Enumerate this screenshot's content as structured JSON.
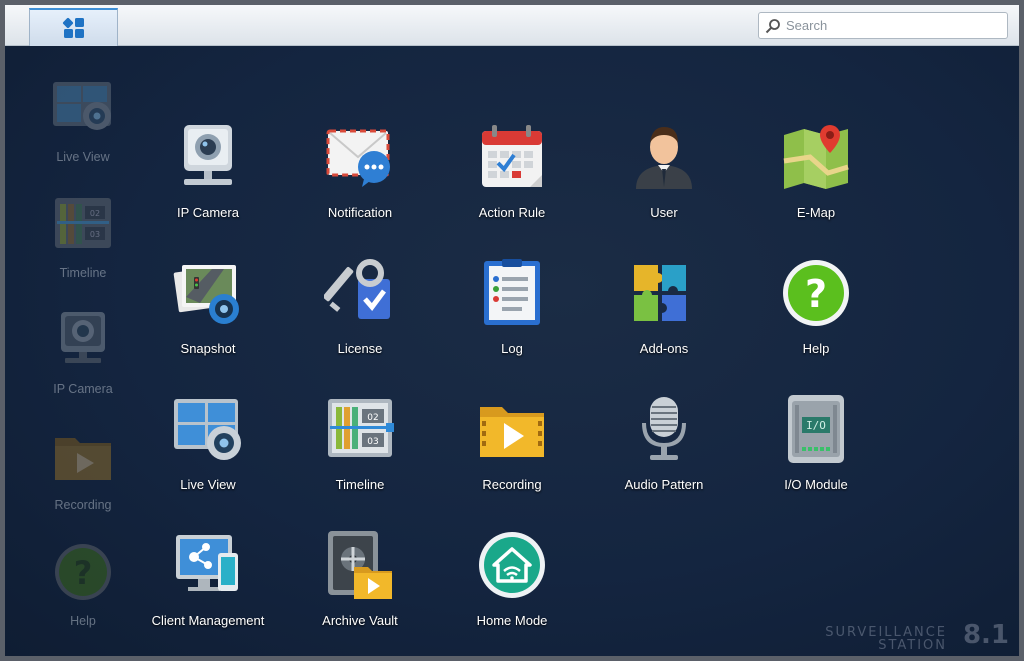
{
  "topbar": {
    "search": {
      "placeholder": "Search",
      "icon": "search-icon"
    },
    "main_menu_icon": "grid-icon"
  },
  "sidebar": {
    "items": [
      {
        "label": "Live View",
        "icon": "live-view-icon"
      },
      {
        "label": "Timeline",
        "icon": "timeline-icon"
      },
      {
        "label": "IP Camera",
        "icon": "ip-camera-icon"
      },
      {
        "label": "Recording",
        "icon": "recording-icon"
      },
      {
        "label": "Help",
        "icon": "help-icon"
      }
    ]
  },
  "apps": [
    {
      "label": "IP Camera",
      "icon": "ip-camera-icon"
    },
    {
      "label": "Notification",
      "icon": "notification-icon"
    },
    {
      "label": "Action Rule",
      "icon": "action-rule-icon"
    },
    {
      "label": "User",
      "icon": "user-icon"
    },
    {
      "label": "E-Map",
      "icon": "e-map-icon"
    },
    {
      "label": "Snapshot",
      "icon": "snapshot-icon"
    },
    {
      "label": "License",
      "icon": "license-icon"
    },
    {
      "label": "Log",
      "icon": "log-icon"
    },
    {
      "label": "Add-ons",
      "icon": "add-ons-icon"
    },
    {
      "label": "Help",
      "icon": "help-icon"
    },
    {
      "label": "Live View",
      "icon": "live-view-icon"
    },
    {
      "label": "Timeline",
      "icon": "timeline-icon"
    },
    {
      "label": "Recording",
      "icon": "recording-icon"
    },
    {
      "label": "Audio Pattern",
      "icon": "audio-pattern-icon"
    },
    {
      "label": "I/O Module",
      "icon": "io-module-icon"
    },
    {
      "label": "Client Management",
      "icon": "client-management-icon"
    },
    {
      "label": "Archive Vault",
      "icon": "archive-vault-icon"
    },
    {
      "label": "Home Mode",
      "icon": "home-mode-icon"
    }
  ],
  "branding": {
    "line1": "SURVEILLANCE",
    "line2": "STATION",
    "version": "8.1"
  },
  "colors": {
    "desktop_bg": "#142540",
    "accent": "#3d8fd6",
    "help_green": "#5bbf1e"
  }
}
